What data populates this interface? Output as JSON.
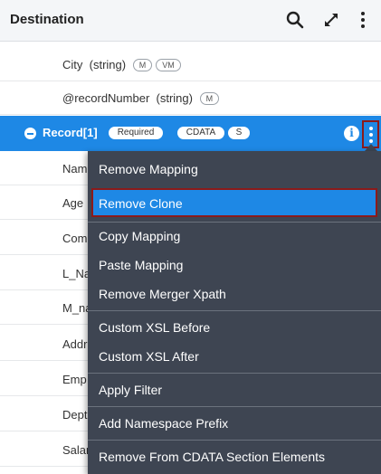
{
  "header": {
    "title": "Destination",
    "icons": [
      "search-icon",
      "expand-icon",
      "more-vertical-icon"
    ]
  },
  "rows": [
    {
      "name": "City",
      "type": "(string)",
      "badges": [
        "M",
        "VM"
      ]
    },
    {
      "name": "@recordNumber",
      "type": "(string)",
      "badges": [
        "M"
      ]
    }
  ],
  "selected_row": {
    "name": "Record[1]",
    "badges": [
      "Required",
      "CDATA",
      "S"
    ],
    "icons": [
      "collapse-icon",
      "info-icon",
      "more-vertical-icon"
    ]
  },
  "partial_rows": [
    "Nam",
    "Age",
    "Com",
    "L_Na",
    "M_na",
    "Addr",
    "Emp",
    "Dept",
    "Salar"
  ],
  "context_menu": {
    "items": [
      "Remove Mapping",
      "Remove Clone",
      "Copy Mapping",
      "Paste Mapping",
      "Remove Merger Xpath",
      "Custom XSL Before",
      "Custom XSL After",
      "Apply Filter",
      "Add Namespace Prefix",
      "Remove From CDATA Section Elements"
    ],
    "highlighted": "Remove Clone"
  },
  "colors": {
    "selection": "#1e88e5",
    "menu_background": "#3e4552",
    "highlight_border": "#8b1a1a"
  }
}
